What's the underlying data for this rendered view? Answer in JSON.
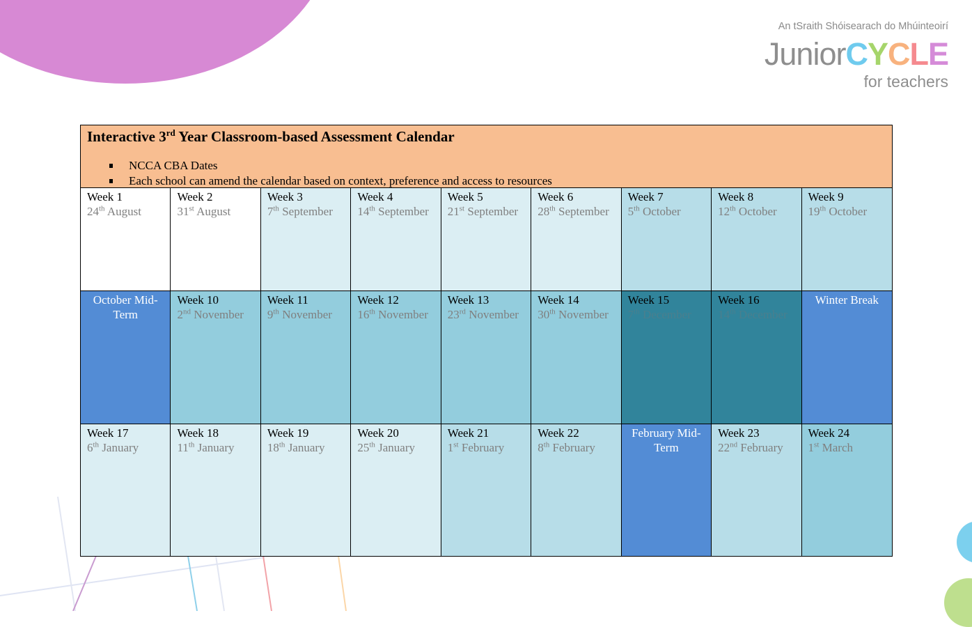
{
  "logo": {
    "irish_line": "An tSraith Shóisearach do Mhúinteoirí",
    "junior": "Junior",
    "cycle_letters": [
      {
        "ch": "C",
        "color": "#6fcbee"
      },
      {
        "ch": "Y",
        "color": "#a6d56b"
      },
      {
        "ch": "C",
        "color": "#f8b27e"
      },
      {
        "ch": "L",
        "color": "#f58a8f"
      },
      {
        "ch": "E",
        "color": "#d58bd8"
      }
    ],
    "subtitle": "for teachers"
  },
  "calendar": {
    "title_prefix": "Interactive 3",
    "title_sup": "rd",
    "title_suffix": " Year Classroom-based Assessment Calendar",
    "bullets": [
      "NCCA CBA Dates",
      "Each school can amend the calendar based on context, preference and access to resources"
    ],
    "colors": {
      "header": "#f8be91",
      "white": "#ffffff",
      "pale": "#dbeef3",
      "light": "#b7dde8",
      "mid": "#93cddd",
      "dark": "#31849b",
      "break": "#538cd5"
    },
    "rows": [
      [
        {
          "week": "Week 1",
          "day": "24",
          "suffix": "th",
          "month": " August",
          "shade": "white"
        },
        {
          "week": "Week 2",
          "day": "31",
          "suffix": "st",
          "month": " August",
          "shade": "white"
        },
        {
          "week": "Week 3",
          "day": "7",
          "suffix": "th",
          "month": " September",
          "shade": "pale"
        },
        {
          "week": "Week 4",
          "day": "14",
          "suffix": "th",
          "month": " September",
          "shade": "pale"
        },
        {
          "week": "Week 5",
          "day": "21",
          "suffix": "st",
          "month": " September",
          "shade": "pale"
        },
        {
          "week": "Week 6",
          "day": "28",
          "suffix": "th",
          "month": " September",
          "shade": "pale"
        },
        {
          "week": "Week 7",
          "day": "5",
          "suffix": "th",
          "month": " October",
          "shade": "light"
        },
        {
          "week": "Week 8",
          "day": "12",
          "suffix": "th",
          "month": " October",
          "shade": "light"
        },
        {
          "week": "Week 9",
          "day": "19",
          "suffix": "th",
          "month": " October",
          "shade": "light"
        }
      ],
      [
        {
          "label": "October Mid-Term",
          "shade": "break"
        },
        {
          "week": "Week 10",
          "day": "2",
          "suffix": "nd",
          "month": " November",
          "shade": "mid"
        },
        {
          "week": "Week 11",
          "day": "9",
          "suffix": "th",
          "month": " November",
          "shade": "mid"
        },
        {
          "week": "Week 12",
          "day": "16",
          "suffix": "th",
          "month": " November",
          "shade": "mid"
        },
        {
          "week": "Week 13",
          "day": "23",
          "suffix": "rd",
          "month": " November",
          "shade": "mid"
        },
        {
          "week": "Week 14",
          "day": "30",
          "suffix": "th",
          "month": " November",
          "shade": "mid"
        },
        {
          "week": "Week 15",
          "day": "7",
          "suffix": "th",
          "month": " December",
          "shade": "dark"
        },
        {
          "week": "Week 16",
          "day": "14",
          "suffix": "th",
          "month": " December",
          "shade": "dark"
        },
        {
          "label": "Winter Break",
          "shade": "break"
        }
      ],
      [
        {
          "week": "Week 17",
          "day": "6",
          "suffix": "th",
          "month": " January",
          "shade": "pale"
        },
        {
          "week": "Week 18",
          "day": "11",
          "suffix": "th",
          "month": " January",
          "shade": "pale"
        },
        {
          "week": "Week 19",
          "day": "18",
          "suffix": "th",
          "month": " January",
          "shade": "pale"
        },
        {
          "week": "Week 20",
          "day": "25",
          "suffix": "th",
          "month": " January",
          "shade": "pale"
        },
        {
          "week": "Week 21",
          "day": "1",
          "suffix": "st",
          "month": " February",
          "shade": "light"
        },
        {
          "week": "Week 22",
          "day": "8",
          "suffix": "th",
          "month": " February",
          "shade": "light"
        },
        {
          "label": "February Mid-Term",
          "shade": "break"
        },
        {
          "week": "Week 23",
          "day": "22",
          "suffix": "nd",
          "month": " February",
          "shade": "light"
        },
        {
          "week": "Week 24",
          "day": "1",
          "suffix": "st",
          "month": " March",
          "shade": "mid"
        }
      ]
    ]
  }
}
